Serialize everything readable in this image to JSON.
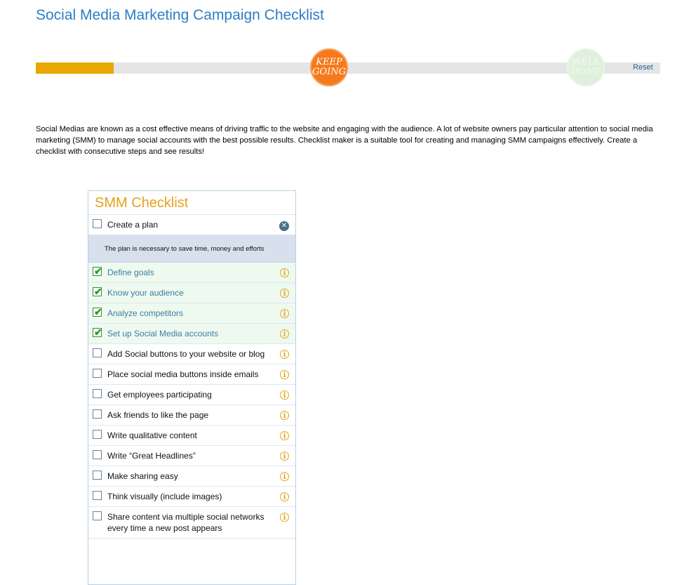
{
  "page": {
    "title": "Social Media Marketing Campaign Checklist",
    "reset_label": "Reset",
    "intro": "Social Medias are known as a cost effective means of driving traffic to the website and engaging with the audience. A lot of website owners pay particular attention to social media marketing (SMM) to manage social accounts with the best possible results. Checklist maker is a suitable tool for creating and managing SMM campaigns effectively. Create a checklist with consecutive steps and see results!"
  },
  "progress": {
    "completed_fraction": 0.125,
    "keep_going": [
      "KEEP",
      "GOING"
    ],
    "well_done": [
      "WELL",
      "DONE"
    ]
  },
  "checklist": {
    "title": "SMM Checklist",
    "items": [
      {
        "label": "Create a plan",
        "checked": false,
        "expanded_note": "The plan is necessary to save time, money and efforts"
      },
      {
        "label": "Define goals",
        "checked": true
      },
      {
        "label": "Know your audience",
        "checked": true
      },
      {
        "label": "Analyze competitors",
        "checked": true
      },
      {
        "label": "Set up Social Media accounts",
        "checked": true
      },
      {
        "label": "Add Social buttons to your website or blog",
        "checked": false
      },
      {
        "label": "Place social media buttons inside emails",
        "checked": false
      },
      {
        "label": "Get employees participating",
        "checked": false
      },
      {
        "label": "Ask friends to like the page",
        "checked": false
      },
      {
        "label": "Write qualitative content",
        "checked": false
      },
      {
        "label": "Write “Great Headlines”",
        "checked": false
      },
      {
        "label": "Make sharing easy",
        "checked": false
      },
      {
        "label": "Think visually (include images)",
        "checked": false
      },
      {
        "label": "Share content via multiple social networks every time a new post appears",
        "checked": false
      }
    ]
  },
  "colors": {
    "title": "#2d7ec4",
    "progress_fill": "#e8a800",
    "badge_keep": "#f57a1c",
    "badge_done": "#dff0dc",
    "checklist_title": "#e5a21d"
  },
  "icons": {
    "close": "close-circle-icon",
    "info": "info-icon",
    "check": "checkmark-icon"
  }
}
